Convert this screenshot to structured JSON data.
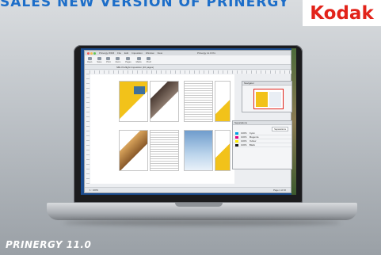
{
  "banner": {
    "headline": "SALES NEW VERSION OF PRINERGY",
    "logo_text": "Kodak",
    "colors": {
      "headline": "#1d6ec9",
      "logo": "#e2231a"
    }
  },
  "footer": {
    "caption": "PRINERGY 11.0"
  },
  "app": {
    "window_title": "Prinergy 11.0 Pro",
    "menu": [
      "Prinergy WFM",
      "File",
      "Edit",
      "Imposition",
      "Window",
      "View"
    ],
    "toolbar": [
      "Open",
      "Save",
      "Print",
      "Zoom",
      "Pages",
      "Marks",
      "Proof"
    ],
    "doc_tab": "SBL  Preflight Imposition  (16 pages)",
    "status_left": "1 : 100%",
    "status_right": "Page 1 of 16"
  },
  "navigator_panel": {
    "title": "Navigator"
  },
  "separations_panel": {
    "title": "Separations",
    "button": "Separations",
    "rows": [
      {
        "name": "Cyan",
        "value": "100%"
      },
      {
        "name": "Magenta",
        "value": "100%"
      },
      {
        "name": "Yellow",
        "value": "100%"
      },
      {
        "name": "Black",
        "value": "100%"
      }
    ],
    "swatch_colors": [
      "#00a0e3",
      "#e6007e",
      "#ffed00",
      "#1a1a1a"
    ]
  }
}
